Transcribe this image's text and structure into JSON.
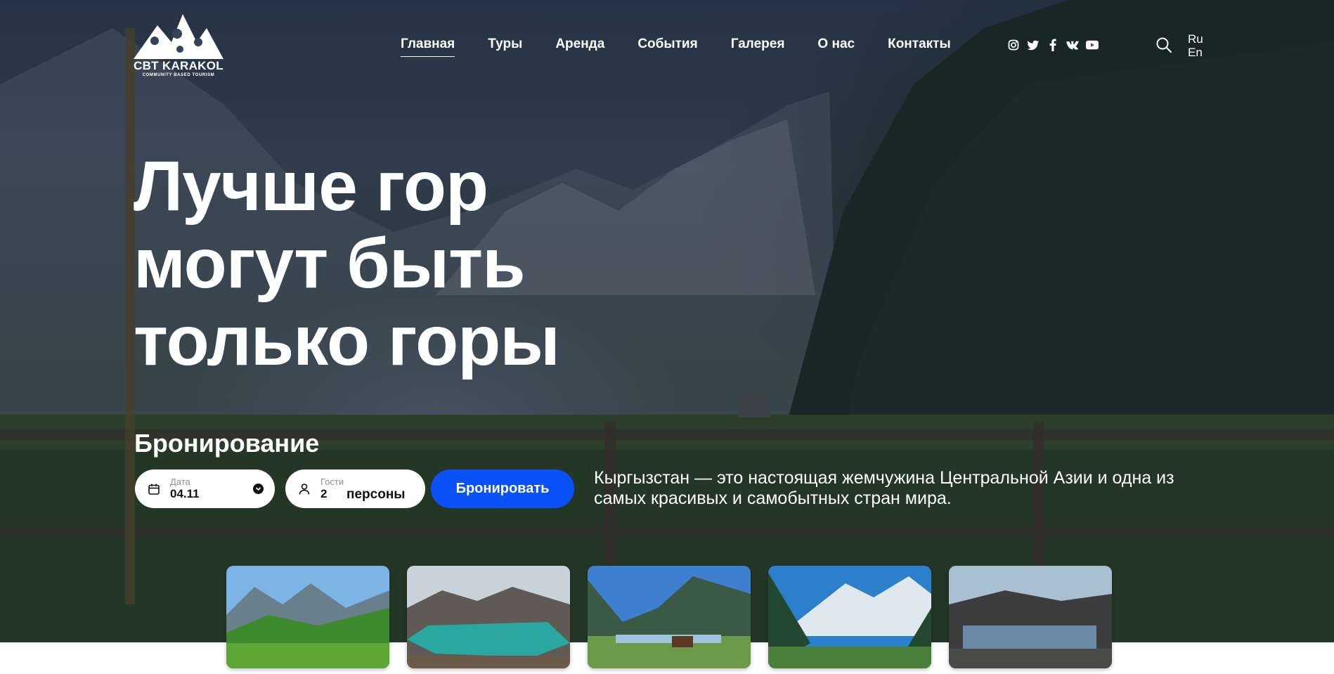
{
  "logo": {
    "name": "CBT KARAKOL",
    "tagline": "COMMUNITY BASED TOURISM"
  },
  "nav": {
    "items": [
      {
        "label": "Главная",
        "active": true
      },
      {
        "label": "Туры"
      },
      {
        "label": "Аренда"
      },
      {
        "label": "События"
      },
      {
        "label": "Галерея"
      },
      {
        "label": "О нас"
      },
      {
        "label": "Контакты"
      }
    ]
  },
  "socials": [
    "instagram-icon",
    "twitter-icon",
    "facebook-icon",
    "vk-icon",
    "youtube-icon"
  ],
  "language": {
    "ru": "Ru",
    "en": "En"
  },
  "hero": {
    "headline_lines": [
      "Лучше гор",
      "могут быть",
      "только горы"
    ],
    "description": "Кыргызстан — это настоящая жемчужина Центральной Азии и одна из самых красивых и самобытных стран мира."
  },
  "booking": {
    "title": "Бронирование",
    "date_label": "Дата",
    "date_value": "04.11",
    "guests_label": "Гости",
    "guests_value": "2",
    "guests_unit": "персоны",
    "submit_label": "Бронировать"
  },
  "gallery": {
    "thumbnails": [
      "valley-meadow",
      "turquoise-lake",
      "horses-river",
      "snow-peaks",
      "glacier-lake"
    ]
  },
  "colors": {
    "accent": "#0a52f5",
    "text_light": "#ffffff"
  }
}
